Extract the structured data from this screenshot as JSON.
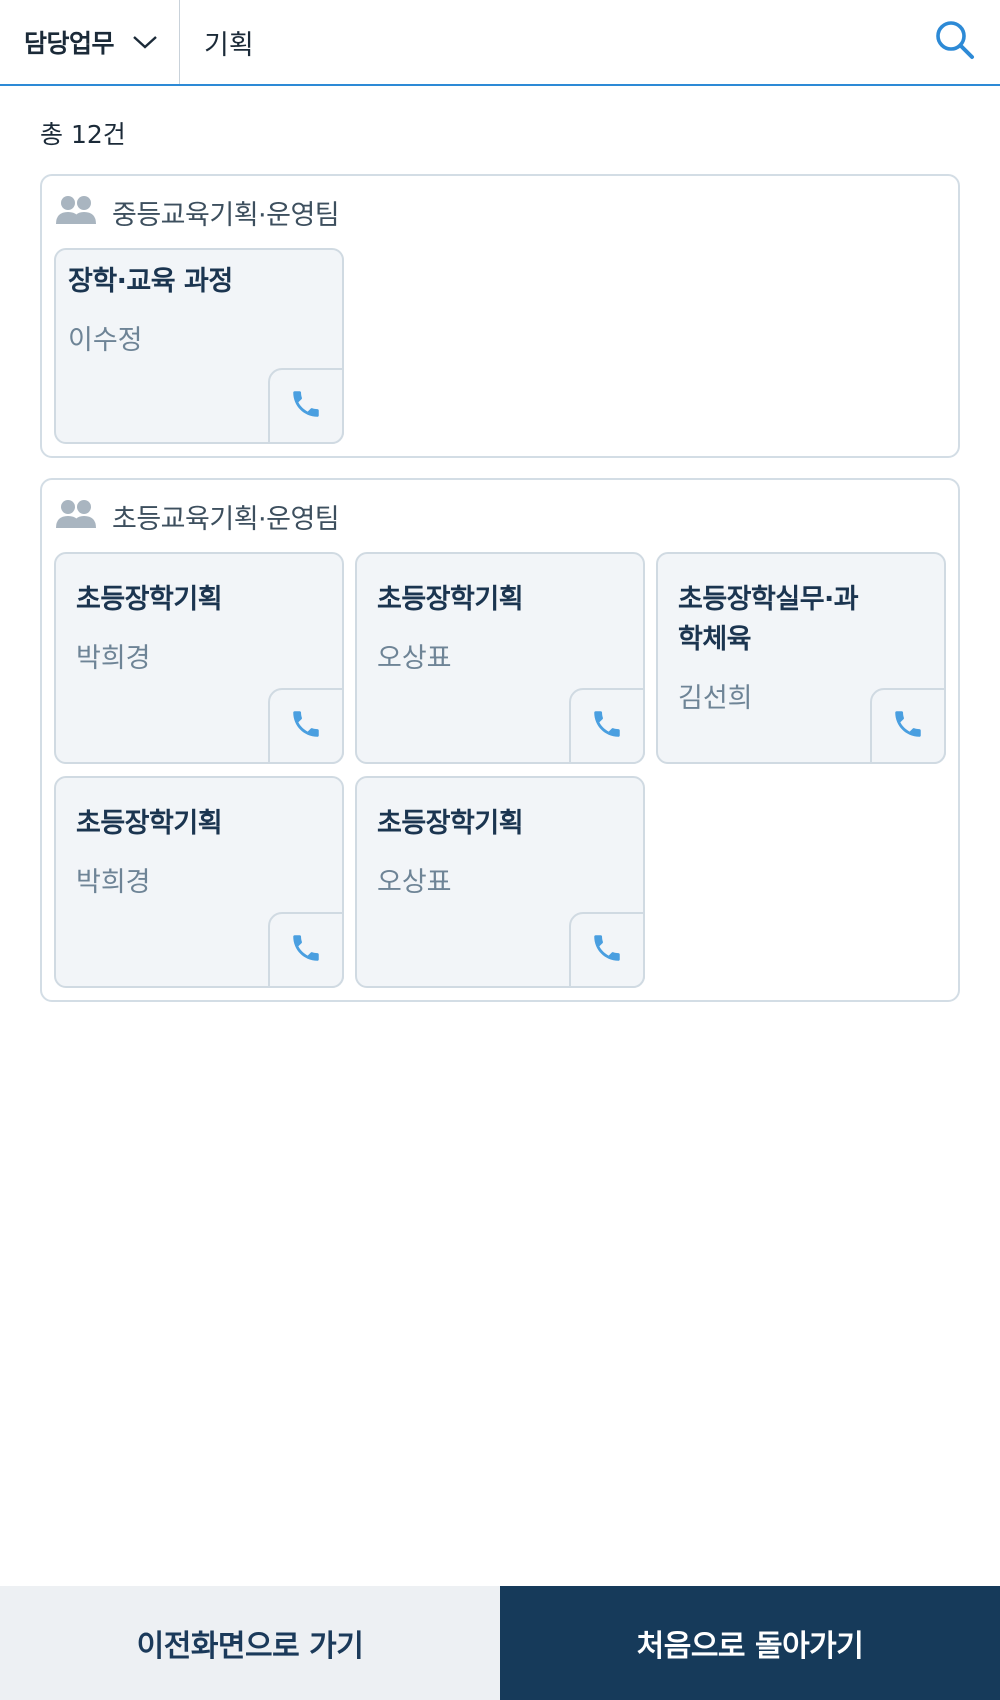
{
  "search": {
    "category_label": "담당업무",
    "query_value": "기획"
  },
  "result_count": "총 12건",
  "groups": [
    {
      "title": "중등교육기획·운영팀",
      "cards": [
        {
          "task": "장학·교육 과정",
          "name": "이수정"
        }
      ]
    },
    {
      "title": "초등교육기획·운영팀",
      "cards": [
        {
          "task": "초등장학기획",
          "name": "박희경"
        },
        {
          "task": "초등장학기획",
          "name": "오상표"
        },
        {
          "task": "초등장학실무·과학체육",
          "name": "김선희"
        },
        {
          "task": "초등장학기획",
          "name": "박희경"
        },
        {
          "task": "초등장학기획",
          "name": "오상표"
        }
      ]
    }
  ],
  "footer": {
    "prev_label": "이전화면으로 가기",
    "home_label": "처음으로 돌아가기"
  },
  "icons": {
    "group": "people-icon",
    "call": "phone-icon",
    "search": "search-icon",
    "dropdown": "chevron-down-icon"
  },
  "colors": {
    "accent": "#2d8ad6",
    "phone": "#4a9fe0",
    "footer_primary": "#163a5a",
    "footer_secondary": "#edf0f3",
    "card_bg": "#f2f5f8"
  }
}
